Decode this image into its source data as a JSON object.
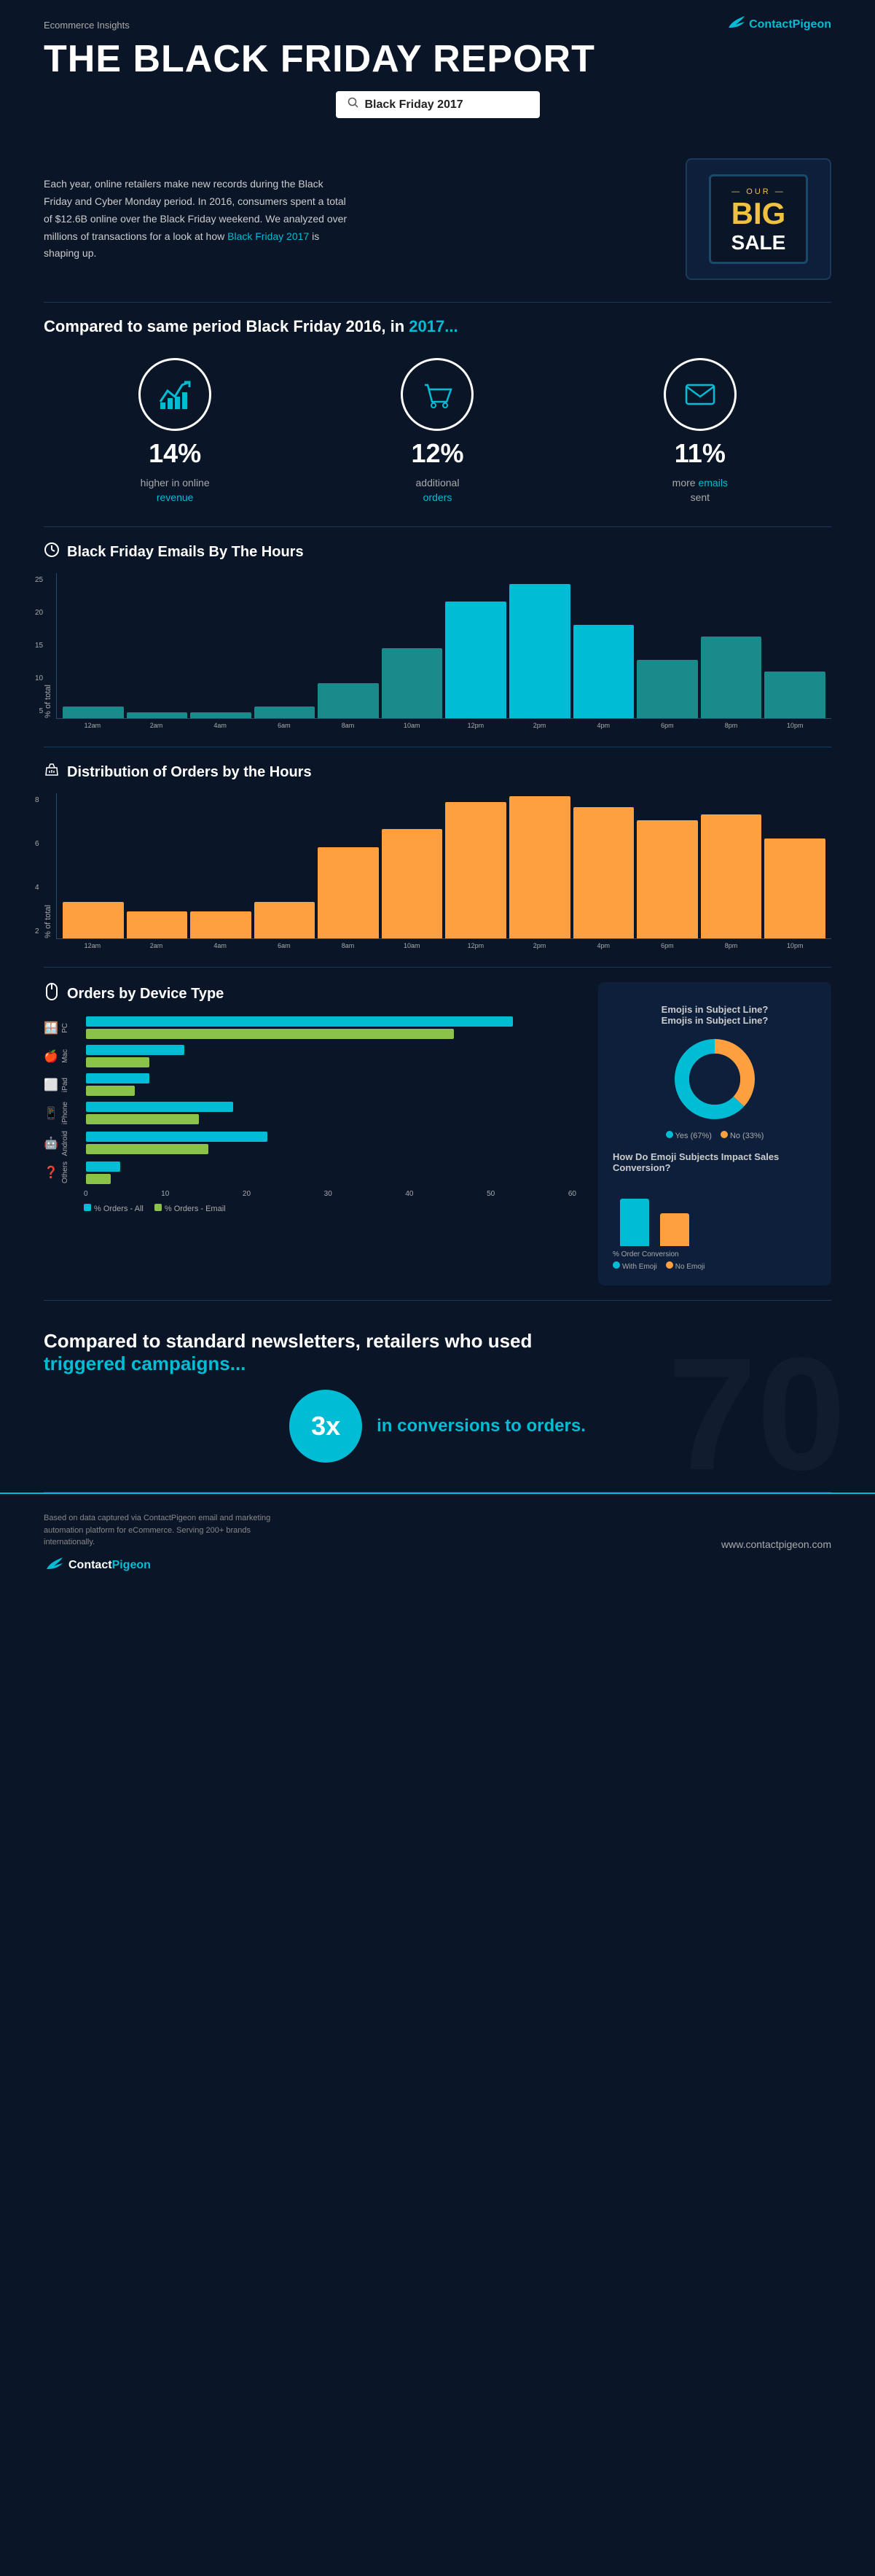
{
  "header": {
    "brand": "Ecommerce Insights",
    "logo_text": "Contact",
    "logo_accent": "Pigeon",
    "main_title": "THE BLACK FRIDAY REPORT",
    "search_value": "Black Friday 2017"
  },
  "intro": {
    "text": "Each year, online retailers make new records during the Black Friday and Cyber Monday period. In 2016, consumers spent a total of $12.6B online over the Black Friday weekend. We analyzed over millions of transactions for a look at how Black Friday 2017 is shaping up.",
    "highlight": "Black Friday 2017",
    "sale": {
      "our": "— OUR —",
      "big": "BIG",
      "sale": "SALE"
    }
  },
  "compare": {
    "title": "Compared to same period Black Friday 2016, in 2017...",
    "year_highlight": "2017...",
    "cards": [
      {
        "percent": "14%",
        "desc_line1": "higher in online",
        "desc_line2": "revenue",
        "highlight": "revenue",
        "icon": "📈"
      },
      {
        "percent": "12%",
        "desc_line1": "additional",
        "desc_line2": "orders",
        "highlight": "orders",
        "icon": "🛒"
      },
      {
        "percent": "11%",
        "desc_line1": "more emails",
        "desc_line2": "sent",
        "highlight": "emails",
        "icon": "✉"
      }
    ]
  },
  "email_chart": {
    "section_title": "Black Friday Emails By The Hours",
    "y_label": "% of total",
    "y_values": [
      "25",
      "20",
      "15",
      "10",
      "5"
    ],
    "x_labels": [
      "12am",
      "2am",
      "4am",
      "6am",
      "8am",
      "10am",
      "12pm",
      "2pm",
      "4pm",
      "6pm",
      "8pm",
      "10pm"
    ],
    "bars": [
      2,
      1,
      1,
      2,
      6,
      12,
      20,
      23,
      16,
      10,
      14,
      8
    ]
  },
  "orders_chart": {
    "section_title": "Distribution of Orders by the Hours",
    "y_label": "% of total",
    "y_values": [
      "8",
      "6",
      "4",
      "2"
    ],
    "x_labels": [
      "12am",
      "2am",
      "4am",
      "6am",
      "8am",
      "10am",
      "12pm",
      "2pm",
      "4pm",
      "6pm",
      "8pm",
      "10pm"
    ],
    "bars": [
      2,
      1.5,
      1.5,
      2,
      5,
      6,
      7.5,
      7.8,
      7.2,
      6.5,
      6.8,
      5.5
    ]
  },
  "device_section": {
    "section_title": "Orders by Device Type",
    "devices": [
      {
        "name": "PC",
        "icon": "🪟",
        "all": 52,
        "email": 45
      },
      {
        "name": "Mac",
        "icon": "🍎",
        "all": 12,
        "email": 8
      },
      {
        "name": "iPad",
        "icon": "⬜",
        "all": 8,
        "email": 6
      },
      {
        "name": "iPhone",
        "icon": "📱",
        "all": 18,
        "email": 14
      },
      {
        "name": "Android",
        "icon": "🤖",
        "all": 22,
        "email": 15
      },
      {
        "name": "Others",
        "icon": "❓",
        "all": 4,
        "email": 3
      }
    ],
    "x_labels": [
      "0",
      "10",
      "20",
      "30",
      "40",
      "50",
      "60"
    ],
    "legend": [
      "% Orders - All",
      "% Orders - Email"
    ]
  },
  "emoji_section": {
    "title": "Emojis in Subject Line?",
    "subtitle": "Emojis in Subject Line?",
    "yes_pct": 67,
    "no_pct": 33,
    "yes_label": "Yes (67%)",
    "no_label": "No (33%)",
    "impact_title": "How Do Emoji Subjects Impact Sales Conversion?",
    "impact_subtitle": "% Order Conversion",
    "with_emoji_label": "With Emoji",
    "no_emoji_label": "No Emoji",
    "with_emoji_val": 65,
    "no_emoji_val": 45
  },
  "triggered": {
    "title_line1": "Compared to standard newsletters, retailers who used",
    "title_line2": "triggered campaigns...",
    "multiplier": "3x",
    "desc": "in conversions to orders."
  },
  "footer": {
    "disclaimer": "Based on data captured via ContactPigeon email and marketing automation platform for eCommerce. Serving 200+ brands internationally.",
    "website": "www.contactpigeon.com",
    "logo_text": "Contact",
    "logo_accent": "Pigeon"
  }
}
